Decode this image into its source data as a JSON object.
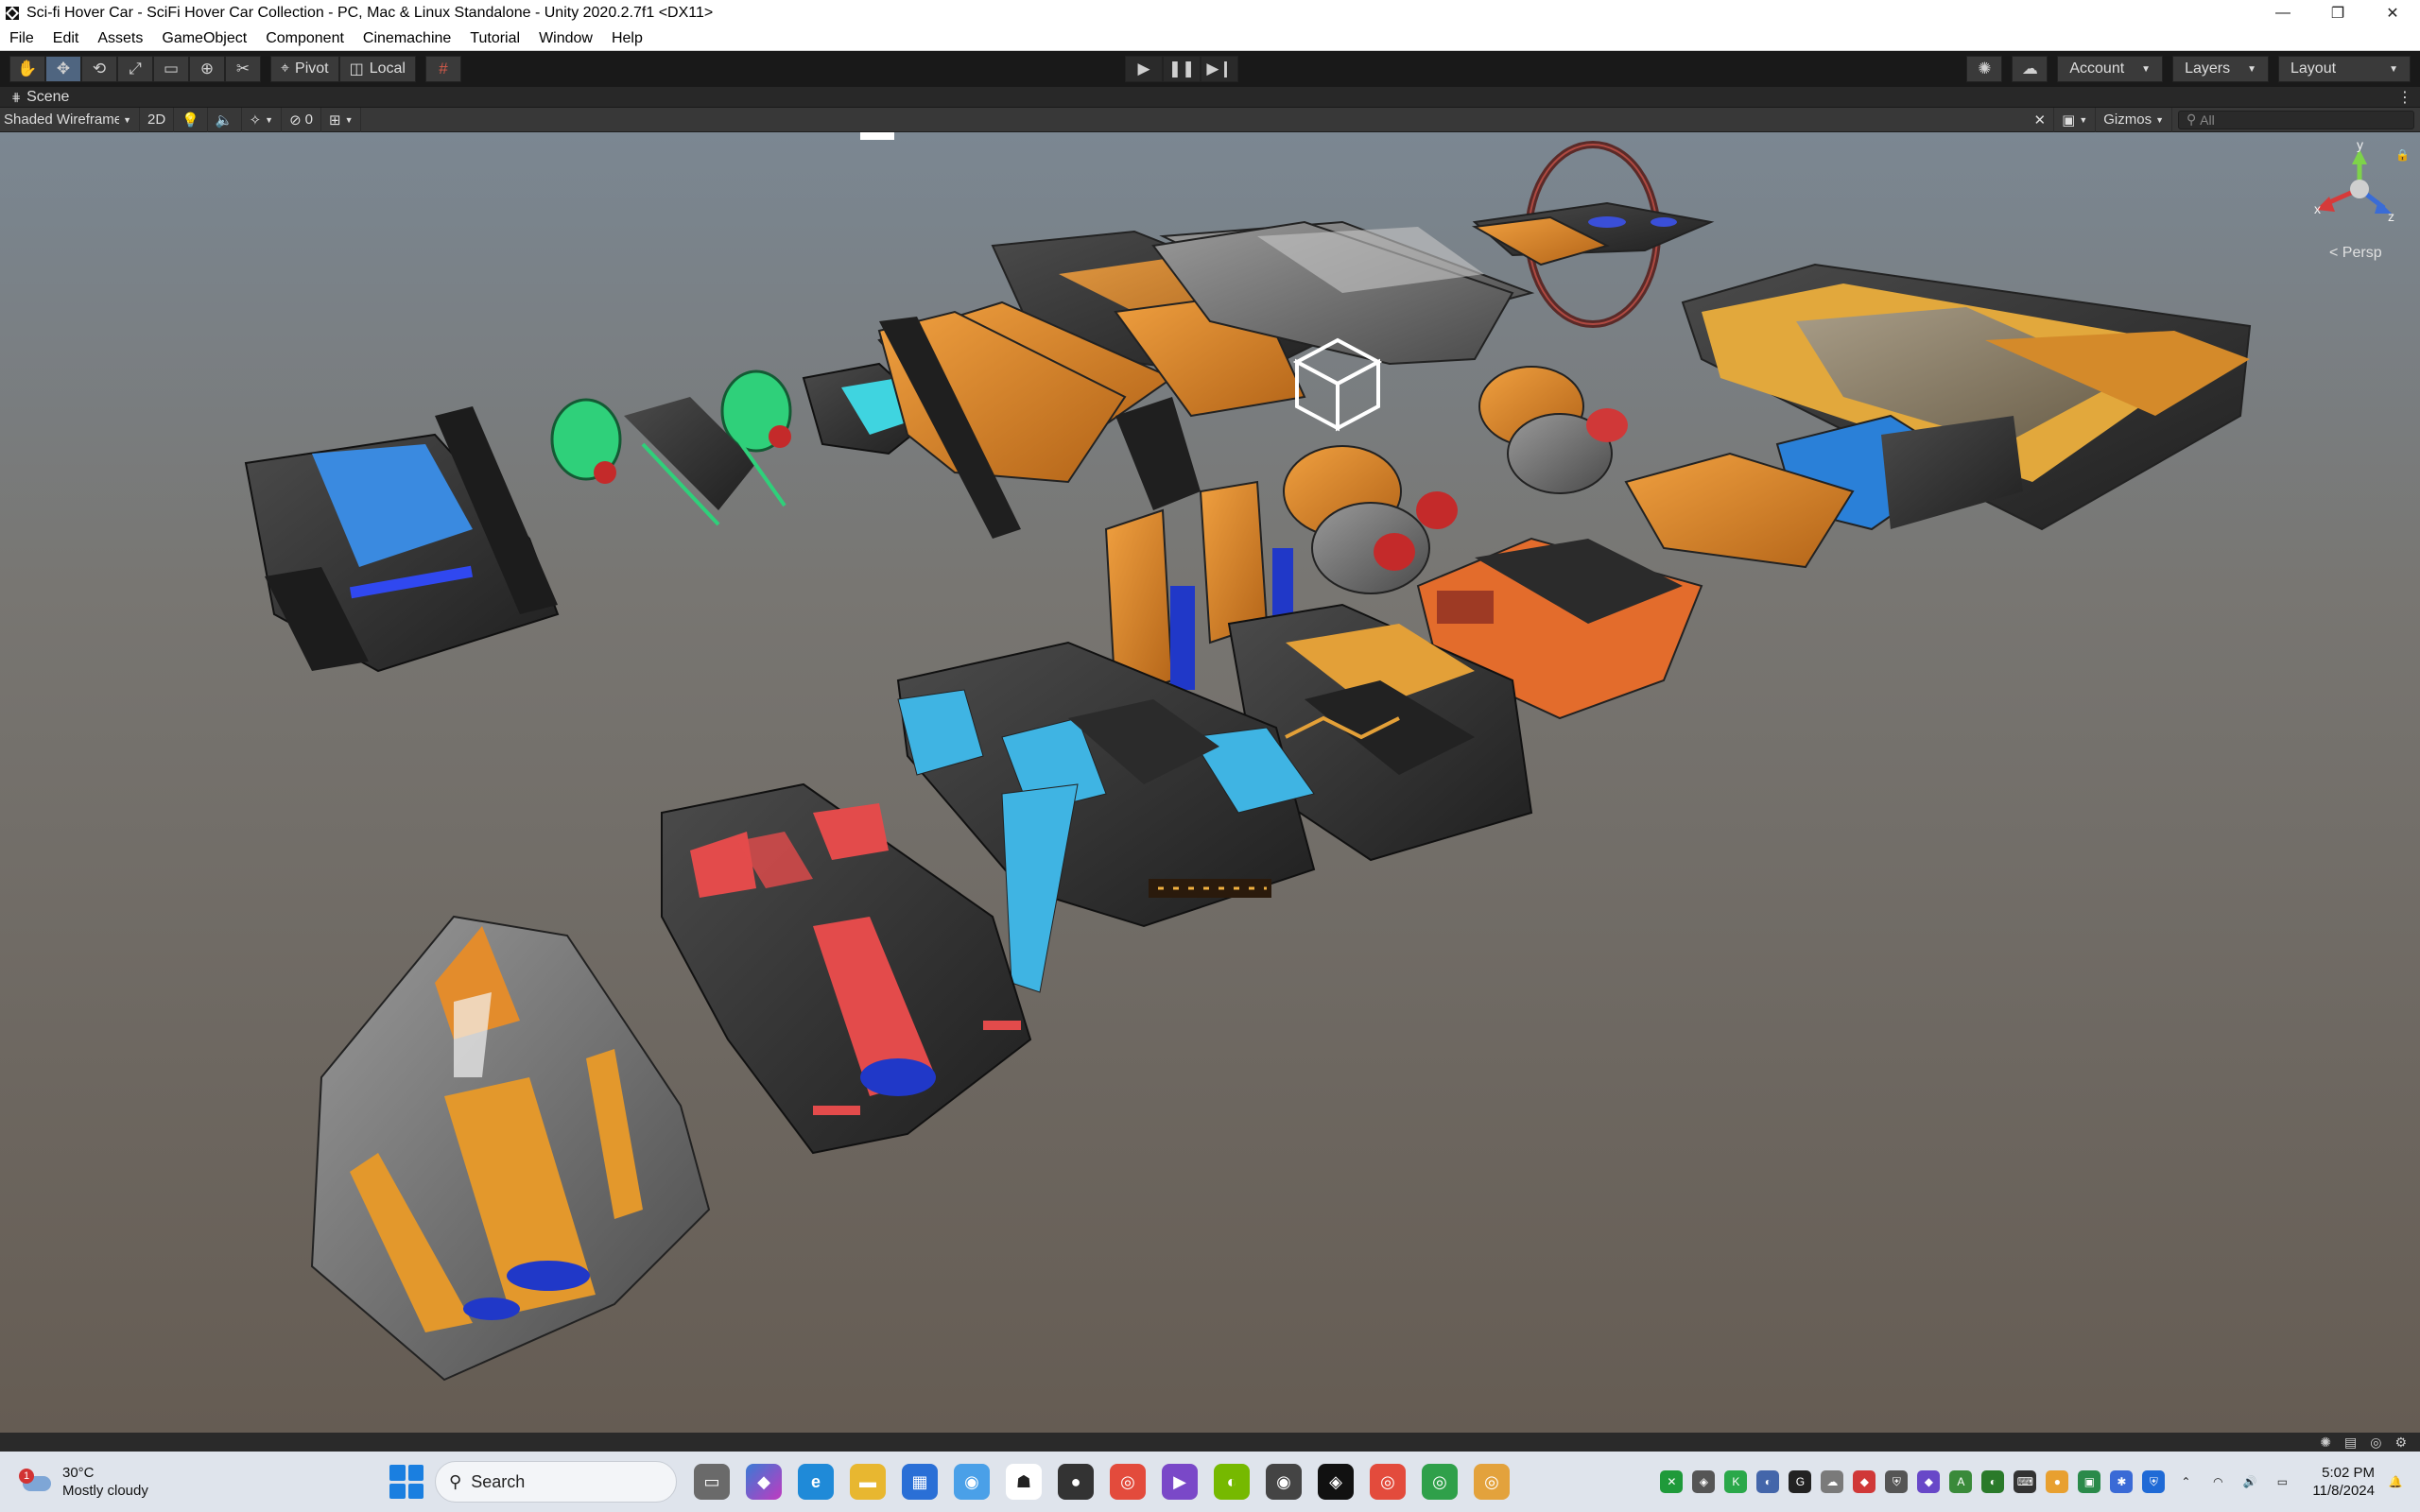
{
  "window": {
    "title": "Sci-fi Hover Car - SciFi Hover Car Collection - PC, Mac & Linux Standalone - Unity 2020.2.7f1 <DX11>",
    "minimize": "—",
    "restore": "❐",
    "close": "✕"
  },
  "menu": {
    "items": [
      "File",
      "Edit",
      "Assets",
      "GameObject",
      "Component",
      "Cinemachine",
      "Tutorial",
      "Window",
      "Help"
    ]
  },
  "toolbar": {
    "pivot": "Pivot",
    "local": "Local",
    "account": "Account",
    "layers": "Layers",
    "layout": "Layout"
  },
  "scene": {
    "tab_label": "Scene",
    "shading_mode": "Shaded Wireframe",
    "mode_2d": "2D",
    "hidden_count": "0",
    "gizmos": "Gizmos",
    "search_placeholder": "All",
    "gizmo_x": "x",
    "gizmo_y": "y",
    "gizmo_z": "z",
    "projection": "< Persp"
  },
  "weather": {
    "badge": "1",
    "temperature": "30°C",
    "condition": "Mostly cloudy"
  },
  "taskbar": {
    "search_label": "Search"
  },
  "clock": {
    "time": "5:02 PM",
    "date": "11/8/2024"
  },
  "colors": {
    "accent_blue": "#1a7fe0",
    "orange_paint": "#d98a2c",
    "cyan_paint": "#3fb4e3",
    "red_paint": "#e34b4b",
    "green_paint": "#2fd07a"
  }
}
